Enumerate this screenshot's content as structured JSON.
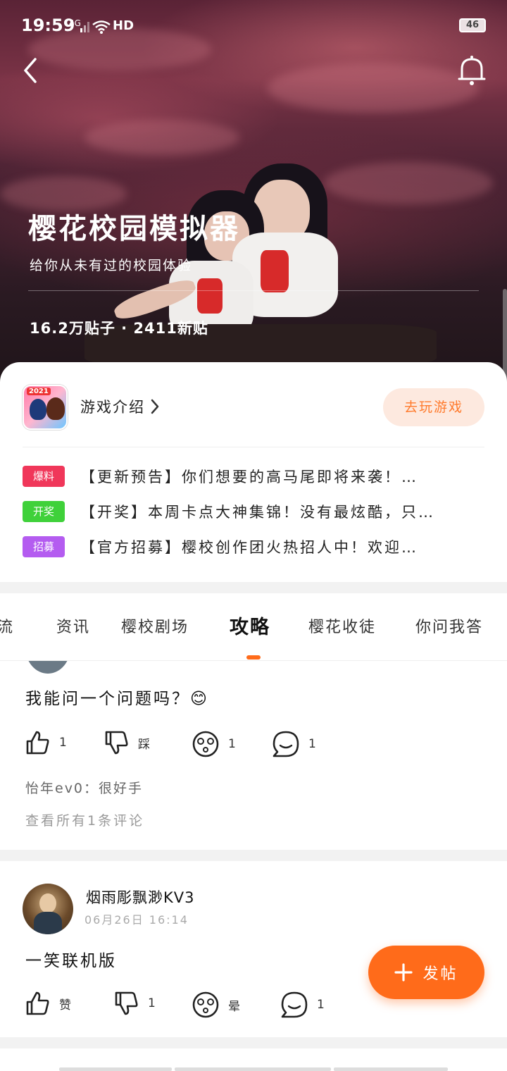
{
  "status_bar": {
    "time": "19:59",
    "network": "4G",
    "hd": "HD",
    "battery": "46"
  },
  "header": {
    "title": "樱花校园模拟器",
    "subtitle": "给你从未有过的校园体验",
    "stats": "16.2万贴子 · 2411新贴"
  },
  "game_card": {
    "icon_year": "2021",
    "intro_label": "游戏介绍",
    "play_label": "去玩游戏",
    "news": [
      {
        "tag": "爆料",
        "tag_color": "#f0375a",
        "text": "【更新预告】你们想要的高马尾即将来袭！…"
      },
      {
        "tag": "开奖",
        "tag_color": "#3fd13a",
        "text": "【开奖】本周卡点大神集锦！没有最炫酷，只…"
      },
      {
        "tag": "招募",
        "tag_color": "#b45cf0",
        "text": "【官方招募】樱校创作团火热招人中！欢迎…"
      }
    ]
  },
  "tabs": [
    {
      "label": "交流"
    },
    {
      "label": "资讯"
    },
    {
      "label": "樱校剧场"
    },
    {
      "label": "攻略"
    },
    {
      "label": "樱花收徒"
    },
    {
      "label": "你问我答"
    }
  ],
  "active_tab": "攻略",
  "posts": [
    {
      "body": "我能问一个问题吗？😊",
      "actions": {
        "like": "1",
        "dislike": "踩",
        "dizzy": "1",
        "comment": "1"
      },
      "comment_preview": "怡年ev0：很好手",
      "view_all": "查看所有1条评论"
    },
    {
      "author": "烟雨彫飘渺KV3",
      "time": "06月26日  16:14",
      "body": "一笑联机版",
      "actions": {
        "like": "赞",
        "dislike": "1",
        "dizzy": "晕",
        "comment": "1"
      }
    }
  ],
  "fab": {
    "label": "发帖"
  },
  "colors": {
    "accent": "#ff6b1a",
    "play_bg": "#fde9df"
  }
}
